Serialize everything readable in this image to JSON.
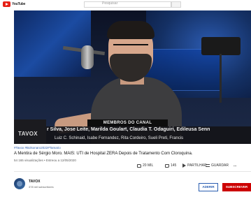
{
  "app": {
    "logo_text": "YouTube",
    "search_placeholder": "Pesquisar"
  },
  "video": {
    "overlay_label": "MEMBROS DO CANAL",
    "overlay_logo": "TAVOX",
    "overlay_names_line1": "r Silva, Jose Leite, Marilda Goulart, Claudia T. Odaguiri, Edileusa Senn",
    "overlay_names_line2": "Luiz C. Schinaid, Isabe Fernandez, Rita Cordeiro, Sueli Preti, Francis"
  },
  "info": {
    "tags": "#Tavox #Bolsonaro2022#Tamario",
    "title": "A Mentira de Sérgio Moro. MAIS: UTI de Hospital ZERA Depois de Tratamento Com Cloroquina.",
    "meta": "54 165 visualizações • Estreou a 12/05/2020"
  },
  "actions": {
    "likes": "20 MIL",
    "dislikes": "145",
    "share": "PARTILHAR",
    "save": "GUARDAR",
    "more": "..."
  },
  "channel": {
    "name": "TAVOX",
    "subscribers": "378 mil subscritores",
    "join_label": "ADERIR",
    "subscribe_label": "SUBSCREVER"
  },
  "colors": {
    "brand_red": "#cc0000",
    "link_blue": "#2a5db0"
  }
}
